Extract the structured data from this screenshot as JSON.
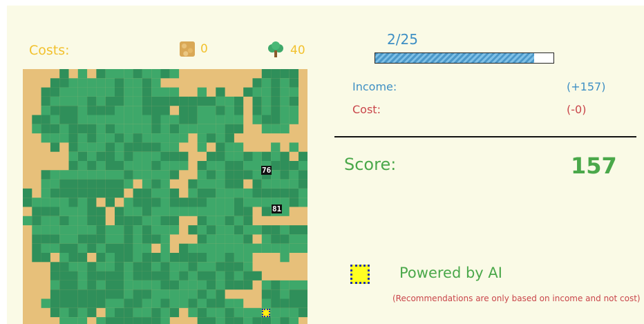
{
  "costs": {
    "label": "Costs:",
    "sand": {
      "icon": "sand-tile-icon",
      "value": "0"
    },
    "tree": {
      "icon": "tree-icon",
      "value": "40"
    }
  },
  "map": {
    "badges": [
      "76",
      "81"
    ],
    "colors": {
      "sand": "#e7c07a",
      "forest": "#3ea86a",
      "forest_dark": "#2f8f5a"
    }
  },
  "progress": {
    "text": "2/25",
    "percent": 89
  },
  "income": {
    "label": "Income:",
    "value": "(+157)"
  },
  "cost": {
    "label": "Cost:",
    "value": "(-0)"
  },
  "score": {
    "label": "Score:",
    "value": "157"
  },
  "ai": {
    "icon": "ai-recommendation-icon",
    "title": "Powered by AI",
    "note": "(Recommendations are only based on income and not cost)"
  },
  "colors": {
    "accent_yellow": "#f2c12e",
    "blue": "#3e8fc4",
    "red": "#c9454a",
    "green": "#4aa84a"
  }
}
